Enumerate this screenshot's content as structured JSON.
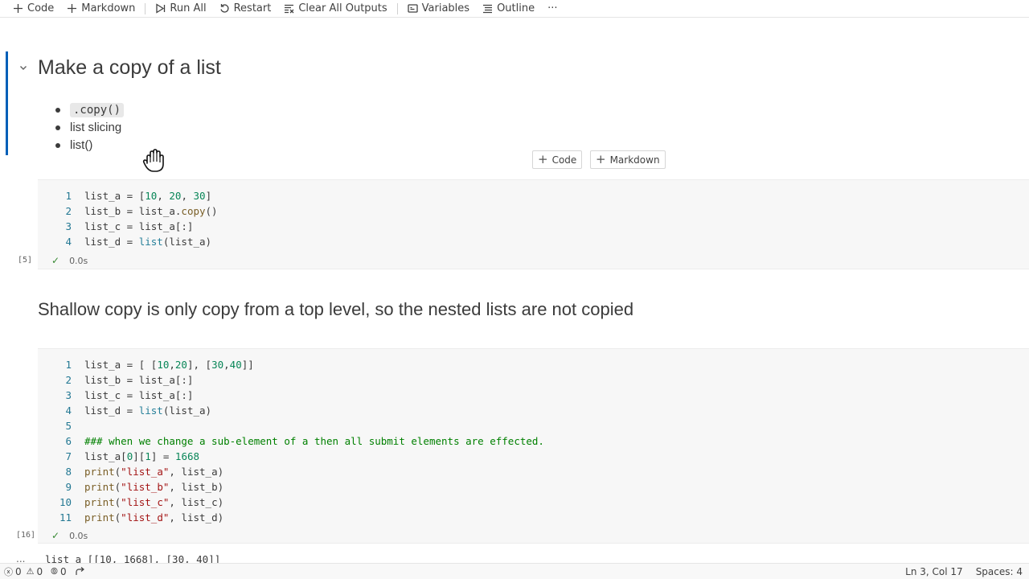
{
  "toolbar": {
    "code": "Code",
    "markdown": "Markdown",
    "run_all": "Run All",
    "restart": "Restart",
    "clear_outputs": "Clear All Outputs",
    "variables": "Variables",
    "outline": "Outline",
    "more": "···"
  },
  "cell1": {
    "heading": "Make a copy of a list",
    "bullets": [
      ".copy()",
      "list slicing",
      "list()"
    ]
  },
  "insert": {
    "code": "Code",
    "markdown": "Markdown"
  },
  "cell2": {
    "exec_count": "[5]",
    "duration": "0.0s",
    "line_numbers": [
      "1",
      "2",
      "3",
      "4"
    ]
  },
  "cell3": {
    "heading": "Shallow copy is only copy from a top level, so the nested lists are not copied"
  },
  "cell4": {
    "exec_count": "[16]",
    "duration": "0.0s",
    "line_numbers": [
      "1",
      "2",
      "3",
      "4",
      "5",
      "6",
      "7",
      "8",
      "9",
      "10",
      "11"
    ],
    "output_marker": "...",
    "output_first_line": "list_a [[10, 1668], [30, 40]]"
  },
  "statusbar": {
    "errors": "0",
    "warnings": "0",
    "ports": "0",
    "position": "Ln 3, Col 17",
    "spaces": "Spaces: 4"
  }
}
